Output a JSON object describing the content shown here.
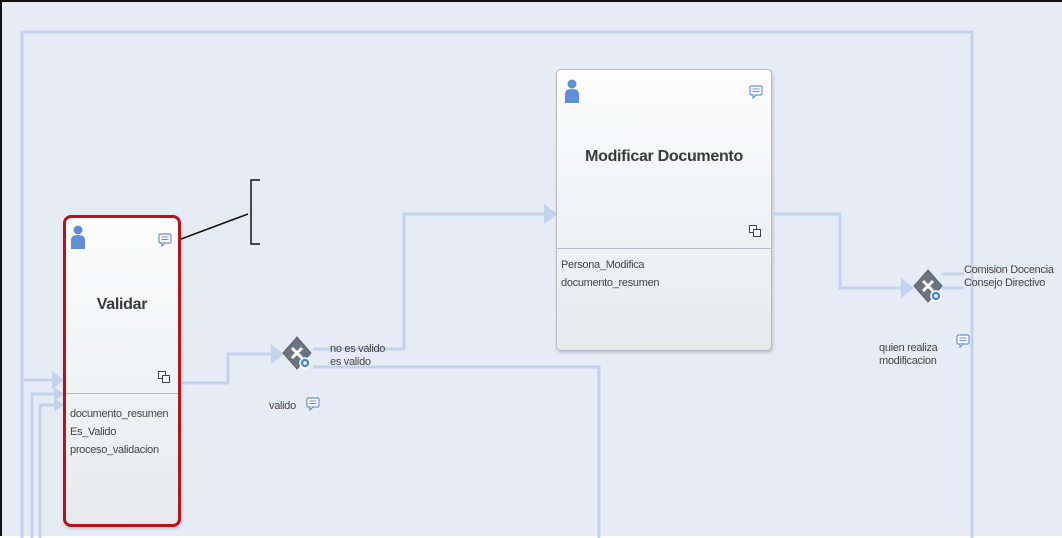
{
  "tasks": {
    "validar": {
      "title": "Validar",
      "variables": [
        "documento_resumen",
        "Es_Valido",
        "proceso_validacion"
      ]
    },
    "modificar": {
      "title": "Modificar Documento",
      "variables": [
        "Persona_Modifica",
        "documento_resumen"
      ]
    }
  },
  "gateways": {
    "valido": {
      "label": "valido",
      "outgoing": [
        "no es valido",
        "es valido"
      ]
    },
    "quien": {
      "label_lines": [
        "quien realiza",
        "modificacion"
      ],
      "outgoing": [
        "Comision Docencia",
        "Consejo Directivo"
      ]
    }
  },
  "colors": {
    "canvas": "#e6ecf6",
    "flow": "#c5d2ec",
    "selected_border": "#b5141b",
    "gateway": "#6c7480",
    "person": "#5f8fd6"
  }
}
